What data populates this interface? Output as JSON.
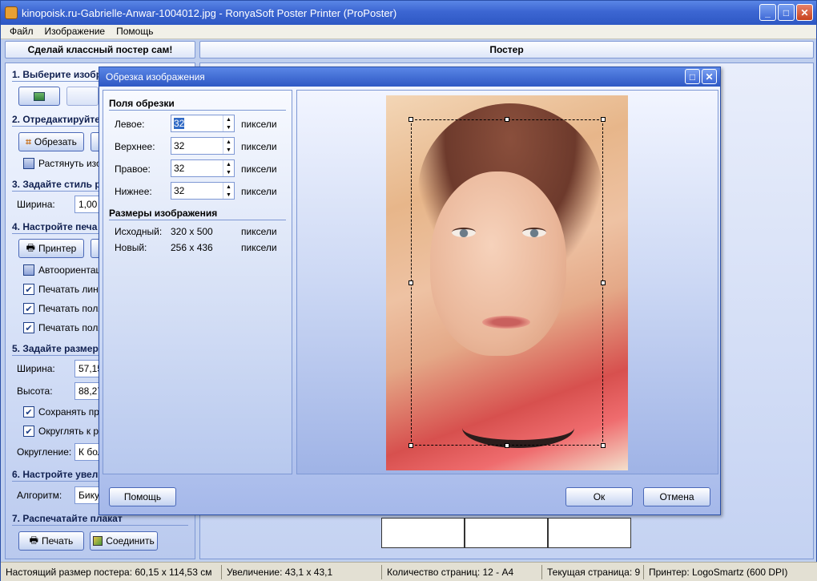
{
  "window": {
    "title": "kinopoisk.ru-Gabrielle-Anwar-1004012.jpg - RonyaSoft Poster Printer (ProPoster)",
    "controls": {
      "minimize": "_",
      "maximize": "□",
      "close": "✕"
    }
  },
  "menu": [
    "Файл",
    "Изображение",
    "Помощь"
  ],
  "headers": {
    "left": "Сделай классный постер сам!",
    "right": "Постер"
  },
  "left": {
    "s1": "1. Выберите изобр",
    "s2": "2. Отредактируйте",
    "crop_btn": "Обрезать",
    "stretch": "Растянуть изо",
    "s3": "3. Задайте стиль р",
    "width_lbl": "Ширина:",
    "width_val": "1,00",
    "s4": "4. Настройте печа",
    "printer_btn": "Принтер",
    "auto": "Автоориентац",
    "print_lines": "Печатать лини",
    "print_fields": "Печатать поля",
    "print_fields2": "Печатать поля",
    "s5": "5. Задайте размер",
    "w_lbl": "Ширина:",
    "w_val": "57,15",
    "h_lbl": "Высота:",
    "h_val": "88,27",
    "keep": "Сохранять про",
    "round": "Округлять к р",
    "rounding_lbl": "Округление:",
    "rounding_val": "К бол",
    "s6": "6. Настройте увел",
    "algo_lbl": "Алгоритм:",
    "algo_val": "Бику",
    "s7": "7. Распечатайте плакат",
    "print_btn": "Печать",
    "join_btn": "Соединить"
  },
  "dialog": {
    "title": "Обрезка изображения",
    "fields_title": "Поля обрезки",
    "left_lbl": "Левое:",
    "left_val": "32",
    "top_lbl": "Верхнее:",
    "top_val": "32",
    "right_lbl": "Правое:",
    "right_val": "32",
    "bottom_lbl": "Нижнее:",
    "bottom_val": "32",
    "unit": "пиксели",
    "size_title": "Размеры изображения",
    "orig_lbl": "Исходный:",
    "orig_val": "320 x 500",
    "new_lbl": "Новый:",
    "new_val": "256 x 436",
    "help_btn": "Помощь",
    "ok_btn": "Ок",
    "cancel_btn": "Отмена"
  },
  "status": {
    "size": "Настоящий размер постера: 60,15 x 114,53 см",
    "zoom": "Увеличение: 43,1 x 43,1",
    "pages": "Количество страниц: 12 - A4",
    "current": "Текущая страница: 9",
    "printer": "Принтер: LogoSmartz (600 DPI)"
  }
}
